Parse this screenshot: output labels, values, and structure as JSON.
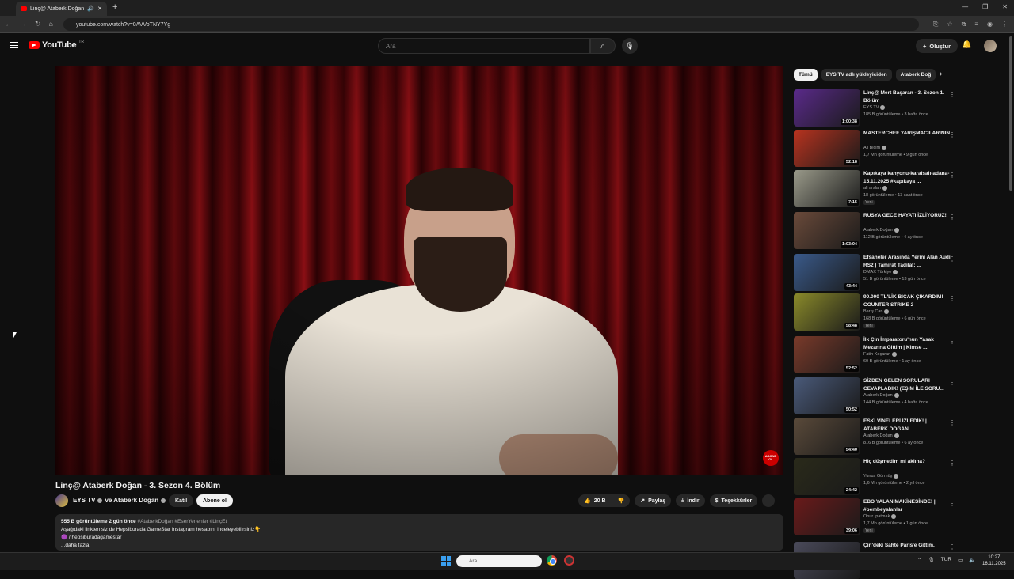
{
  "browser": {
    "tab_title": "Linç@ Ataberk Doğan - 3.",
    "url": "youtube.com/watch?v=0AVVoTNY7Yg",
    "new_tab": "+"
  },
  "header": {
    "logo_text": "YouTube",
    "country_code": "TR",
    "search_placeholder": "Ara",
    "create_label": "Oluştur"
  },
  "video": {
    "title": "Linç@ Ataberk Doğan - 3. Sezon 4. Bölüm",
    "channel": "EYS TV",
    "channel_joiner": "ve Ataberk Doğan",
    "join_label": "Katıl",
    "subscribe_label": "Abone ol",
    "overlay_badge": "ABONE OL",
    "likes": "20 B",
    "share_label": "Paylaş",
    "download_label": "İndir",
    "thanks_label": "Teşekkürler",
    "more_glyph": "⋯",
    "views": "555 B görüntüleme",
    "date": "2 gün önce",
    "hashtags": "#AtaberkDoğan #EserYenenler #LinçEt",
    "desc_line1": "Aşağıdaki linkten siz de Hepsiburada GameStar Instagram hesabını inceleyebilirsiniz👇",
    "desc_line2": "🟣 / hepsiburadagamestar",
    "desc_more": "...daha fazla"
  },
  "sidebar": {
    "chips": [
      "Tümü",
      "EYS TV adlı yükleyiciden",
      "Ataberk Doğ"
    ],
    "items": [
      {
        "title": "Linç@ Mert Başaran - 3. Sezon 1. Bölüm",
        "channel": "EYS TV",
        "stats": "185 B görüntüleme • 3 hafta önce",
        "duration": "1:00:38",
        "thumb": "#5a2a8a",
        "new": ""
      },
      {
        "title": "MASTERCHEF YARIŞMACILARININ ...",
        "channel": "Ali Biçim",
        "stats": "1,7 Mn görüntüleme • 9 gün önce",
        "duration": "52:18",
        "thumb": "#b8331f",
        "new": ""
      },
      {
        "title": "Kapıkaya kanyonu-karaisalı-adana-15.11.2025 #kapıkaya ...",
        "channel": "ali arslan",
        "stats": "18 görüntüleme • 13 saat önce",
        "duration": "7:15",
        "thumb": "#9a9a8a",
        "new": "Yeni"
      },
      {
        "title": "RUSYA GECE HAYATI İZLİYORUZ!",
        "channel": "Ataberk Doğan",
        "stats": "112 B görüntüleme • 4 ay önce",
        "duration": "1:03:04",
        "thumb": "#6a4a3a",
        "new": ""
      },
      {
        "title": "Efsaneler Arasında Yerini Alan Audi RS2 | Tamirat Tadilat: ...",
        "channel": "DMAX Türkiye",
        "stats": "51 B görüntüleme • 13 gün önce",
        "duration": "43:44",
        "thumb": "#3a5a8a",
        "new": ""
      },
      {
        "title": "90.000 TL'LİK BIÇAK ÇIKARDIM! COUNTER STRIKE 2",
        "channel": "Barış Can",
        "stats": "168 B görüntüleme • 6 gün önce",
        "duration": "58:48",
        "thumb": "#8a8a2a",
        "new": "Yeni"
      },
      {
        "title": "İlk Çin İmparatoru'nun Yasak Mezarına Gittim | Kimse ...",
        "channel": "Fatih Koçaran",
        "stats": "60 B görüntüleme • 1 ay önce",
        "duration": "52:52",
        "thumb": "#7a3a2a",
        "new": ""
      },
      {
        "title": "SİZDEN GELEN SORULARI CEVAPLADIK! (EŞİM İLE SORU...",
        "channel": "Ataberk Doğan",
        "stats": "144 B görüntüleme • 4 hafta önce",
        "duration": "50:52",
        "thumb": "#4a5a7a",
        "new": ""
      },
      {
        "title": "ESKİ VİNELERİ İZLEDİK! | ATABERK DOĞAN",
        "channel": "Ataberk Doğan",
        "stats": "816 B görüntüleme • 6 ay önce",
        "duration": "54:40",
        "thumb": "#5a4a3a",
        "new": ""
      },
      {
        "title": "Hiç düşmedim mi aklına?",
        "channel": "Yunus Gürmüş",
        "stats": "1,6 Mn görüntüleme • 2 yıl önce",
        "duration": "24:42",
        "thumb": "#2a2a1a",
        "new": ""
      },
      {
        "title": "EBO YALAN MAKİNESİNDE! | #pembeyalanlar",
        "channel": "Onur İpatmak",
        "stats": "1,7 Mn görüntüleme • 1 gün önce",
        "duration": "39:06",
        "thumb": "#6a1a1a",
        "new": "Yeni"
      },
      {
        "title": "Çin'deki Sahte Paris'e Gittim.",
        "channel": "",
        "stats": "",
        "duration": "",
        "thumb": "#4a4a5a",
        "new": ""
      }
    ]
  },
  "taskbar": {
    "search_placeholder": "Ara",
    "lang": "TUR",
    "time": "10:27",
    "date": "16.11.2025"
  }
}
